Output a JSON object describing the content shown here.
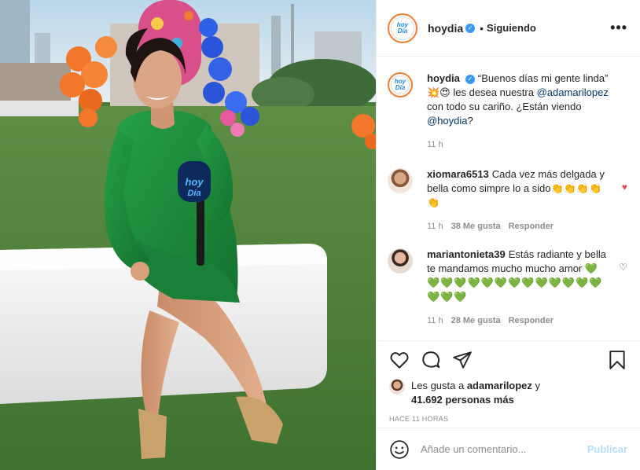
{
  "header": {
    "username": "hoydia",
    "separator": "•",
    "follow_status": "Siguiendo",
    "more": "•••",
    "logo_text": [
      "hoy",
      "Día"
    ]
  },
  "caption": {
    "username": "hoydia",
    "text_a": "“Buenos días mi gente linda” 💥😍 les desea nuestra ",
    "mention_a": "@adamarilopez",
    "text_b": " con todo su cariño. ¿Están viendo ",
    "mention_b": "@hoydia",
    "text_c": "?",
    "time": "11 h"
  },
  "comments": [
    {
      "username": "xiomara6513",
      "text": "Cada vez más delgada y bella como simpre lo a sido👏👏👏👏👏",
      "time": "11 h",
      "likes": "38 Me gusta",
      "reply": "Responder",
      "liked": true,
      "heart": "♥"
    },
    {
      "username": "mariantonieta39",
      "text": "Estás radiante y bella te mandamos mucho mucho amor ",
      "hearts": "💚💚💚💚💚💚💚💚💚💚💚💚💚💚💚💚💚",
      "time": "11 h",
      "likes": "28 Me gusta",
      "reply": "Responder",
      "liked": false,
      "heart": "♡"
    }
  ],
  "likes": {
    "prefix": "Les gusta a ",
    "user": "adamarilopez",
    "middle": " y ",
    "count": "41.692 personas más"
  },
  "timestamp": "HACE 11 HORAS",
  "comment_box": {
    "placeholder": "Añade un comentario...",
    "publish": "Publicar"
  },
  "photo": {
    "mic_text": "hoy Día"
  },
  "colors": {
    "accent_blue": "#3897f0",
    "publish_disabled": "#b2dffc",
    "liked_heart": "#ed4956",
    "dress_green": "#1f8a3c"
  }
}
